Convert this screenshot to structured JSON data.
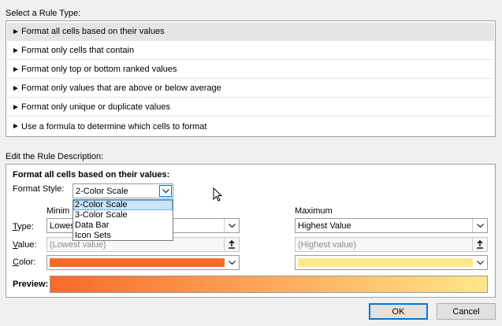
{
  "select_rule_label": "Select a Rule Type:",
  "rule_types": [
    "Format all cells based on their values",
    "Format only cells that contain",
    "Format only top or bottom ranked values",
    "Format only values that are above or below average",
    "Format only unique or duplicate values",
    "Use a formula to determine which cells to format"
  ],
  "edit_rule_label": "Edit the Rule Description:",
  "description": {
    "heading": "Format all cells based on their values:",
    "format_style_label": "Format Style:",
    "format_style_value": "2-Color Scale",
    "format_style_options": [
      "2-Color Scale",
      "3-Color Scale",
      "Data Bar",
      "Icon Sets"
    ],
    "minimum_label": "Minim",
    "maximum_label": "Maximum",
    "type_label": "Type:",
    "value_label": "Value:",
    "color_label": "Color:",
    "min_type": "Lowes",
    "max_type": "Highest Value",
    "min_value_placeholder": "(Lowest value)",
    "max_value_placeholder": "(Highest value)",
    "min_color": "#f8692b",
    "max_color": "#ffe68a",
    "preview_label": "Preview:"
  },
  "buttons": {
    "ok": "OK",
    "cancel": "Cancel"
  },
  "icons": {
    "rule_arrow": "►",
    "dropdown": "chevron-down-icon",
    "refbox": "range-select-icon"
  }
}
